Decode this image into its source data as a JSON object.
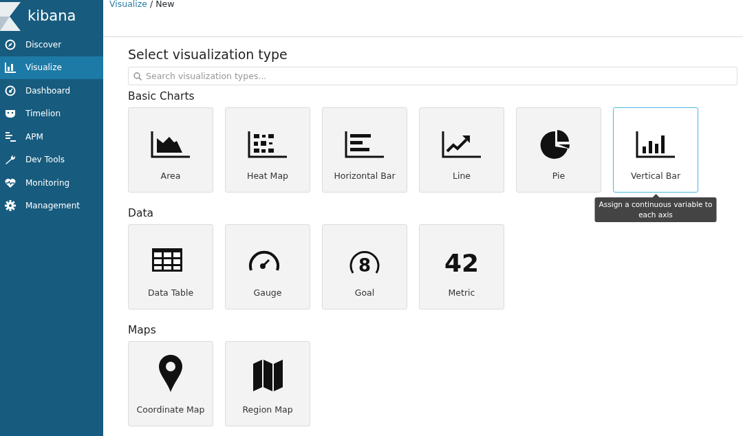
{
  "sidebar": {
    "logo_text": "kibana",
    "items": [
      {
        "label": "Discover",
        "kind": "compass",
        "selected": false
      },
      {
        "label": "Visualize",
        "kind": "barchart",
        "selected": true
      },
      {
        "label": "Dashboard",
        "kind": "dial",
        "selected": false
      },
      {
        "label": "Timelion",
        "kind": "mask",
        "selected": false
      },
      {
        "label": "APM",
        "kind": "lines",
        "selected": false
      },
      {
        "label": "Dev Tools",
        "kind": "wrench",
        "selected": false
      },
      {
        "label": "Monitoring",
        "kind": "heart",
        "selected": false
      },
      {
        "label": "Management",
        "kind": "gear",
        "selected": false
      }
    ]
  },
  "breadcrumb": [
    {
      "label": "Visualize",
      "link": true
    },
    {
      "label": "/",
      "link": false
    },
    {
      "label": "New",
      "link": false
    }
  ],
  "title": "Select visualization type",
  "search": {
    "placeholder": "Search visualization types..."
  },
  "sections": [
    {
      "heading": "Basic Charts",
      "cards": [
        {
          "label": "Area",
          "kind": "area",
          "selected": false
        },
        {
          "label": "Heat Map",
          "kind": "heatmap",
          "selected": false
        },
        {
          "label": "Horizontal Bar",
          "kind": "hbar",
          "selected": false
        },
        {
          "label": "Line",
          "kind": "line",
          "selected": false
        },
        {
          "label": "Pie",
          "kind": "pie",
          "selected": false
        },
        {
          "label": "Vertical Bar",
          "kind": "vbar",
          "selected": true,
          "tooltip": "Assign a continuous variable to each axis"
        }
      ]
    },
    {
      "heading": "Data",
      "cards": [
        {
          "label": "Data Table",
          "kind": "table",
          "selected": false
        },
        {
          "label": "Gauge",
          "kind": "gauge",
          "selected": false
        },
        {
          "label": "Goal",
          "kind": "goal",
          "selected": false,
          "icon_text": "8"
        },
        {
          "label": "Metric",
          "kind": "metric",
          "selected": false,
          "icon_text": "42"
        }
      ]
    },
    {
      "heading": "Maps",
      "cards": [
        {
          "label": "Coordinate Map",
          "kind": "pin",
          "selected": false
        },
        {
          "label": "Region Map",
          "kind": "map",
          "selected": false
        }
      ]
    }
  ]
}
